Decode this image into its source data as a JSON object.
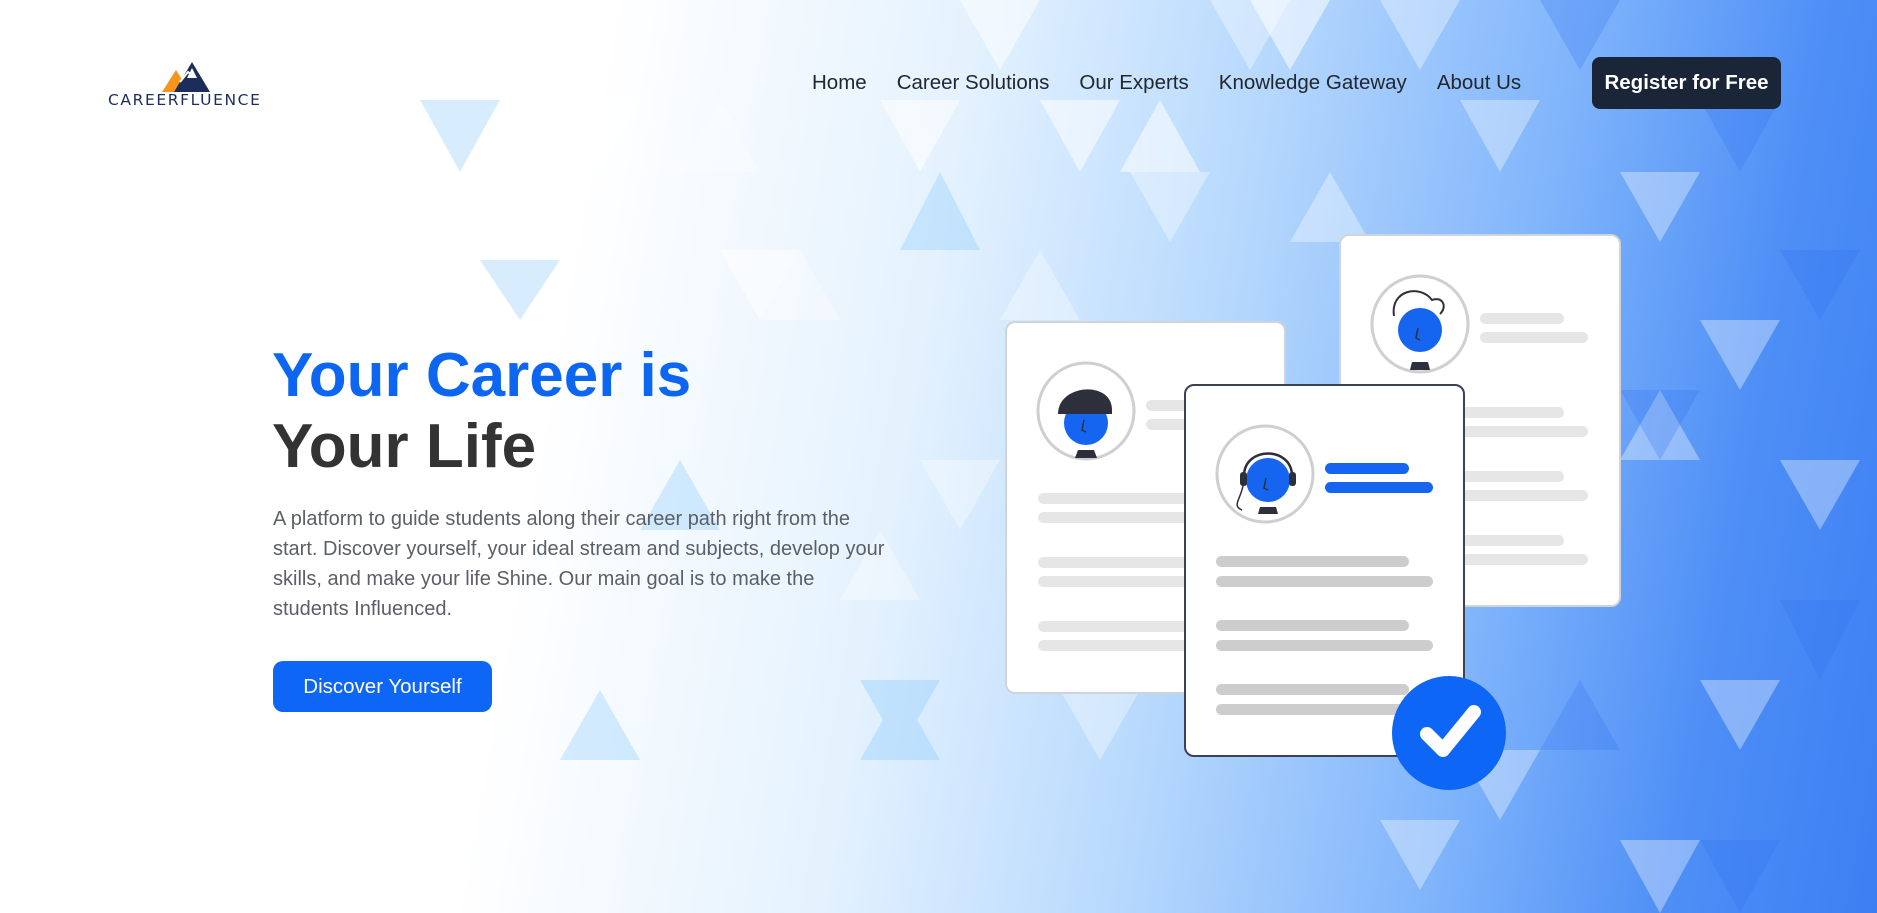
{
  "brand": {
    "name": "CAREERFLUENCE",
    "colors": {
      "navy": "#1c2d5c",
      "orange": "#f7941d",
      "blue": "#0d66f2"
    }
  },
  "nav": {
    "items": [
      {
        "label": "Home"
      },
      {
        "label": "Career Solutions"
      },
      {
        "label": "Our Experts"
      },
      {
        "label": "Knowledge Gateway"
      },
      {
        "label": "About Us"
      }
    ],
    "register_label": "Register for Free"
  },
  "hero": {
    "title_line1": "Your Career is",
    "title_line2": "Your Life",
    "description": "A platform to guide students along their career path right from the start. Discover yourself, your ideal stream and subjects, develop your skills, and make your life Shine. Our main goal is to make the students Influenced.",
    "cta_label": "Discover Yourself"
  },
  "illustration": {
    "icons": [
      "avatar-cap-icon",
      "avatar-hair-icon",
      "avatar-headset-icon",
      "checkmark-icon"
    ]
  }
}
